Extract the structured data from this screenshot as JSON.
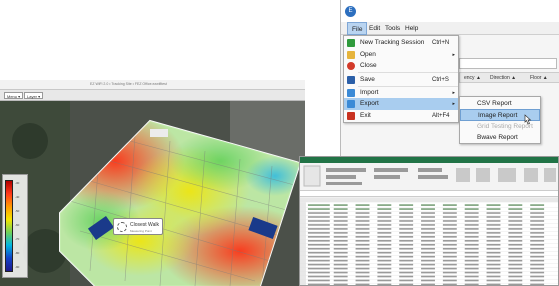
{
  "map_window": {
    "title": "EZ WiFi 2.0 • Tracking Site • FEZ Office.ezwifitest",
    "toolbar_buttons": [
      "Menu ▾",
      "Layer ▾"
    ],
    "legend_ticks": [
      "-30",
      "-40",
      "-50",
      "-60",
      "-70",
      "-80",
      "-90"
    ],
    "tooltip_title": "Closest Walk",
    "tooltip_sub": "Measuring Point"
  },
  "app": {
    "logo": "E",
    "menu": [
      "File",
      "Edit",
      "Tools",
      "Help"
    ],
    "columns": [
      "ency ▲",
      "Direction ▲",
      "Floor ▲"
    ]
  },
  "file_menu": {
    "items": [
      {
        "label": "New Tracking Session",
        "shortcut": "Ctrl+N",
        "icon": "plus-icon",
        "color": "#2f9a3c"
      },
      {
        "label": "Open",
        "shortcut": "",
        "icon": "folder-icon",
        "color": "#e6b43c",
        "arrow": "▸"
      },
      {
        "label": "Close",
        "shortcut": "",
        "icon": "close-icon",
        "color": "#d23a2a"
      },
      {
        "label": "Save",
        "shortcut": "Ctrl+S",
        "icon": "save-icon",
        "color": "#2b5fa8"
      },
      {
        "label": "Import",
        "shortcut": "",
        "icon": "import-icon",
        "color": "#3b8ad6",
        "arrow": "▸"
      },
      {
        "label": "Export",
        "shortcut": "",
        "icon": "export-icon",
        "color": "#3b8ad6",
        "arrow": "▸"
      },
      {
        "label": "Exit",
        "shortcut": "Alt+F4",
        "icon": "exit-icon",
        "color": "#c8311f"
      }
    ]
  },
  "export_menu": {
    "items": [
      "CSV Report",
      "Image Report",
      "Grid Testing Report",
      "Bwave Report"
    ]
  },
  "colors": {
    "menu_highlight": "#a9cdef",
    "excel_green": "#217346"
  }
}
